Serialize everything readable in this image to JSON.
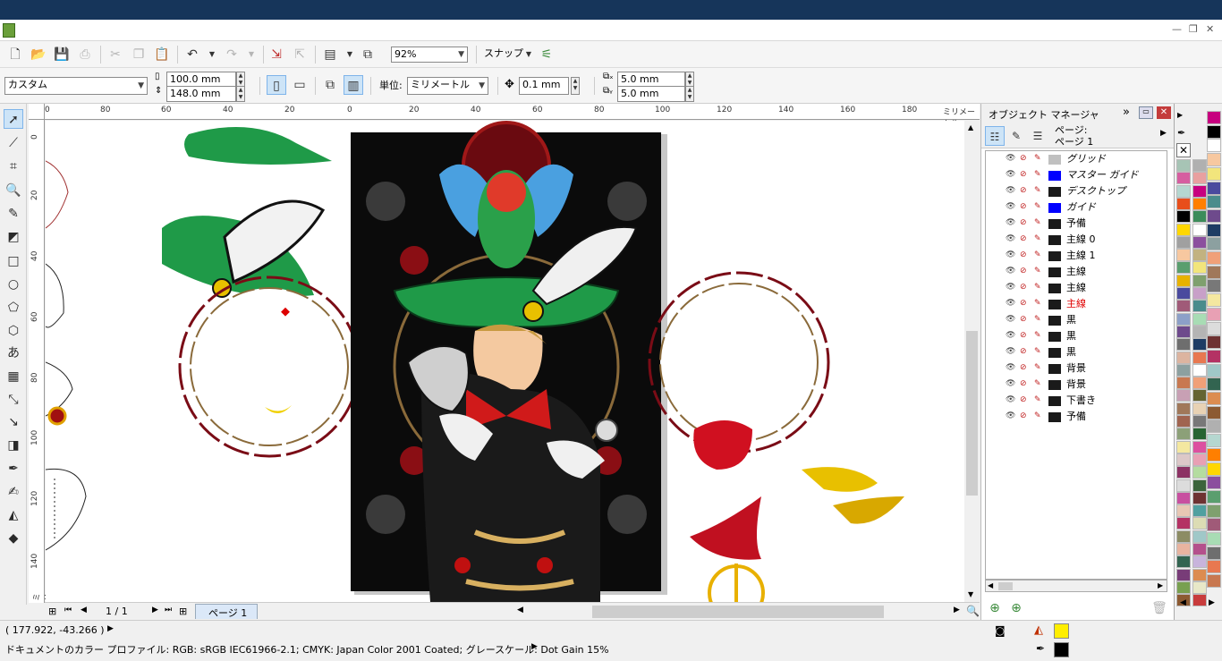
{
  "menubar": {
    "win_min": "—",
    "win_restore": "❐",
    "win_close": "✕"
  },
  "toolbar1": {
    "zoom_value": "92%",
    "snap_label": "スナップ"
  },
  "toolbar2": {
    "paper_preset": "カスタム",
    "width": "100.0 mm",
    "height": "148.0 mm",
    "units_label": "単位:",
    "units_value": "ミリメートル",
    "nudge": "0.1 mm",
    "dup_x": "5.0 mm",
    "dup_y": "5.0 mm"
  },
  "ruler": {
    "h_ticks": [
      "0",
      "80",
      "60",
      "40",
      "20",
      "0",
      "20",
      "40",
      "60",
      "80",
      "100",
      "120",
      "140",
      "160",
      "180",
      "ミリメートル"
    ],
    "v_ticks": [
      "0",
      "20",
      "40",
      "60",
      "80",
      "100",
      "120",
      "140",
      "ミリメートル"
    ]
  },
  "pagenav": {
    "page_count": "1 / 1",
    "page_tab": "ページ 1"
  },
  "docker": {
    "title": "オブジェクト マネージャ",
    "page_label_1": "ページ:",
    "page_label_2": "ページ 1",
    "layers": [
      {
        "name": "グリッド",
        "color": "#c0c0c0",
        "italic": true,
        "red": false
      },
      {
        "name": "マスター ガイド",
        "color": "#0000ff",
        "italic": true,
        "red": false
      },
      {
        "name": "デスクトップ",
        "color": "#1a1a1a",
        "italic": true,
        "red": false
      },
      {
        "name": "ガイド",
        "color": "#0000ff",
        "italic": true,
        "red": false
      },
      {
        "name": "予備",
        "color": "#1a1a1a",
        "italic": false,
        "red": false
      },
      {
        "name": "主線 0",
        "color": "#1a1a1a",
        "italic": false,
        "red": false
      },
      {
        "name": "主線 1",
        "color": "#1a1a1a",
        "italic": false,
        "red": false
      },
      {
        "name": "主線",
        "color": "#1a1a1a",
        "italic": false,
        "red": false
      },
      {
        "name": "主線",
        "color": "#1a1a1a",
        "italic": false,
        "red": false
      },
      {
        "name": "主線",
        "color": "#1a1a1a",
        "italic": false,
        "red": true
      },
      {
        "name": "黒",
        "color": "#1a1a1a",
        "italic": false,
        "red": false
      },
      {
        "name": "黒",
        "color": "#1a1a1a",
        "italic": false,
        "red": false
      },
      {
        "name": "黒",
        "color": "#1a1a1a",
        "italic": false,
        "red": false
      },
      {
        "name": "背景",
        "color": "#1a1a1a",
        "italic": false,
        "red": false
      },
      {
        "name": "背景",
        "color": "#1a1a1a",
        "italic": false,
        "red": false
      },
      {
        "name": "下書き",
        "color": "#1a1a1a",
        "italic": false,
        "red": false
      },
      {
        "name": "予備",
        "color": "#1a1a1a",
        "italic": false,
        "red": false
      }
    ]
  },
  "palette": {
    "colors": [
      "#a7c4b5",
      "#b0b0b0",
      "#d65ea0",
      "#e8a0a0",
      "#b5d7d0",
      "#c7007f",
      "#e84e1b",
      "#ff7f00",
      "#000000",
      "#3c8c5a",
      "#ffd700",
      "#ffffff",
      "#a0a0a0",
      "#8b4f9e",
      "#f7c8a0",
      "#c2b280",
      "#5a9e6e",
      "#f2e57c",
      "#e8b200",
      "#7fa06e",
      "#4a4a9e",
      "#c8a0c8",
      "#a05a78",
      "#4a8c8c",
      "#8ca0c8",
      "#a8dcb4",
      "#6e4a8c",
      "#b4b4b4",
      "#6e6e6e",
      "#1e3c64",
      "#dcb4a0",
      "#e87850",
      "#8ca0a0",
      "#ffffff",
      "#c87850",
      "#f0a078",
      "#c8a0b4",
      "#646432",
      "#a0785a",
      "#e8d2b4",
      "#a06450",
      "#787878",
      "#8ca078",
      "#286432",
      "#f4e8a0",
      "#dc50a0",
      "#dcc8c8",
      "#e8a0b4",
      "#8c3264",
      "#b4dca0",
      "#dcdcdc",
      "#3c643c",
      "#c850a0",
      "#6e3232",
      "#e8c8b4",
      "#50a0a0",
      "#b43264",
      "#dcdcb4",
      "#8c8c64",
      "#a0c8c8",
      "#e8b4a0",
      "#b4508c",
      "#326450",
      "#c8b4dc",
      "#783c78",
      "#dc8c50",
      "#78a050",
      "#e8e8c8",
      "#8c5a32",
      "#c83c3c"
    ],
    "fill_swatch": "#ffee00",
    "outline_swatch": "#000000"
  },
  "status": {
    "coords": "( 177.922, -43.266 )",
    "profile": "ドキュメントのカラー プロファイル: RGB: sRGB IEC61966-2.1; CMYK: Japan Color 2001 Coated; グレースケール: Dot Gain 15%"
  }
}
